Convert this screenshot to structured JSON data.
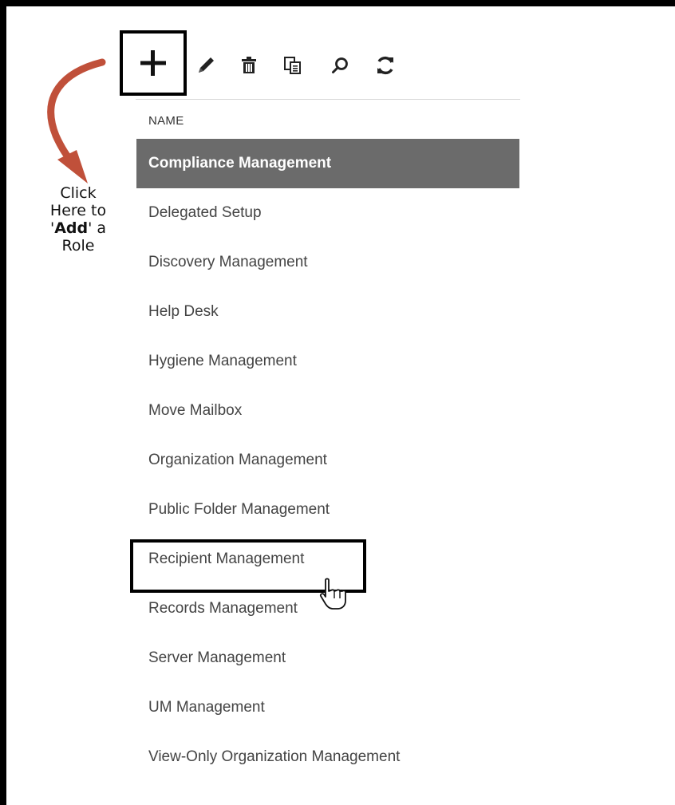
{
  "toolbar": {
    "items": [
      {
        "name": "add",
        "icon": "plus-icon"
      },
      {
        "name": "edit",
        "icon": "pencil-icon"
      },
      {
        "name": "delete",
        "icon": "trash-icon"
      },
      {
        "name": "copy",
        "icon": "copy-icon"
      },
      {
        "name": "search",
        "icon": "search-icon"
      },
      {
        "name": "refresh",
        "icon": "refresh-icon"
      }
    ]
  },
  "list": {
    "column_header": "NAME",
    "selected_index": 0,
    "rows": [
      "Compliance Management",
      "Delegated Setup",
      "Discovery Management",
      "Help Desk",
      "Hygiene Management",
      "Move Mailbox",
      "Organization Management",
      "Public Folder Management",
      "Recipient Management",
      "Records Management",
      "Server Management",
      "UM Management",
      "View-Only Organization Management"
    ]
  },
  "annotation": {
    "line1": "Click",
    "line2": "Here to",
    "line3_quote_open": "'",
    "line3_bold": "Add",
    "line3_rest": "' a",
    "line4": "Role",
    "arrow_color": "#c0503a"
  }
}
